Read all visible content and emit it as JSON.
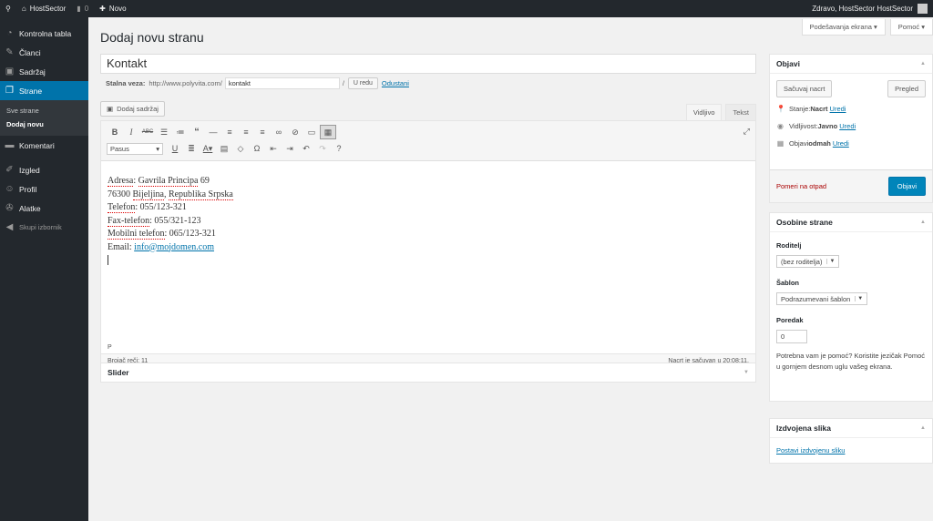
{
  "admin_bar": {
    "site_name": "HostSector",
    "comments_count": "0",
    "new_label": "Novo",
    "greeting": "Zdravo, HostSector HostSector"
  },
  "sidebar": {
    "items": [
      {
        "label": "Kontrolna tabla",
        "icon": "dashboard-icon"
      },
      {
        "label": "Članci",
        "icon": "pushpin-icon"
      },
      {
        "label": "Sadržaj",
        "icon": "media-icon"
      },
      {
        "label": "Strane",
        "icon": "pages-icon"
      },
      {
        "label": "Komentari",
        "icon": "comments-icon"
      },
      {
        "label": "Izgled",
        "icon": "appearance-icon"
      },
      {
        "label": "Profil",
        "icon": "profile-icon"
      },
      {
        "label": "Alatke",
        "icon": "tools-icon"
      }
    ],
    "submenu": [
      "Sve strane",
      "Dodaj novu"
    ],
    "collapse_label": "Skupi izbornik"
  },
  "screen_options": {
    "settings_label": "Podešavanja ekrana",
    "help_label": "Pomoć"
  },
  "page_title": "Dodaj novu stranu",
  "post_title": "Kontakt",
  "permalink": {
    "label": "Stalna veza:",
    "base": "http://www.polyvita.com/",
    "slug": "kontakt",
    "ok_label": "U redu",
    "cancel_label": "Odustani"
  },
  "editor": {
    "add_media_label": "Dodaj sadržaj",
    "tab_visual": "Vidljivo",
    "tab_text": "Tekst",
    "format_select": "Pasus",
    "content_lines": [
      {
        "prefix": "",
        "spell": "Adresa",
        "rest": ": ",
        "spell2": "Gavrila Principa",
        "rest2": " 69"
      },
      {
        "prefix": "76300 ",
        "spell": "Bijeljina",
        "rest": ", ",
        "spell2": "Republika Srpska",
        "rest2": ""
      },
      {
        "prefix": "",
        "spell": "Telefon",
        "rest": ": 055/123-321",
        "spell2": "",
        "rest2": ""
      },
      {
        "prefix": "",
        "spell": "Fax-telefon",
        "rest": ": 055/321-123",
        "spell2": "",
        "rest2": ""
      },
      {
        "prefix": "",
        "spell": "Mobilni telefon",
        "rest": ": 065/123-321",
        "spell2": "",
        "rest2": ""
      }
    ],
    "email_label": "Email: ",
    "email_link": "info@mojdomen.com",
    "path": "P",
    "word_count": "Brojač reči: 11",
    "draft_saved": "Nacrt je sačuvan u 20:08:11."
  },
  "slider_box_title": "Slider",
  "publish": {
    "title": "Objavi",
    "save_draft_label": "Sačuvaj nacrt",
    "preview_label": "Pregled",
    "status_label": "Stanje: ",
    "status_value": "Nacrt",
    "visibility_label": "Vidljivost: ",
    "visibility_value": "Javno",
    "schedule_label": "Objavi ",
    "schedule_value": "odmah",
    "edit_label": "Uredi",
    "trash_label": "Pomeri na otpad",
    "publish_label": "Objavi"
  },
  "page_attributes": {
    "title": "Osobine strane",
    "parent_label": "Roditelj",
    "parent_value": "(bez roditelja)",
    "template_label": "Šablon",
    "template_value": "Podrazumevani šablon",
    "order_label": "Poredak",
    "order_value": "0",
    "help_text": "Potrebna vam je pomoć? Koristite jezičak Pomoć u gornjem desnom uglu vašeg ekrana."
  },
  "featured_image": {
    "title": "Izdvojena slika",
    "set_label": "Postavi izdvojenu sliku"
  },
  "colors": {
    "accent": "#0073aa",
    "primary_button": "#0085ba",
    "admin_dark": "#23282d",
    "trash": "#a00000"
  }
}
